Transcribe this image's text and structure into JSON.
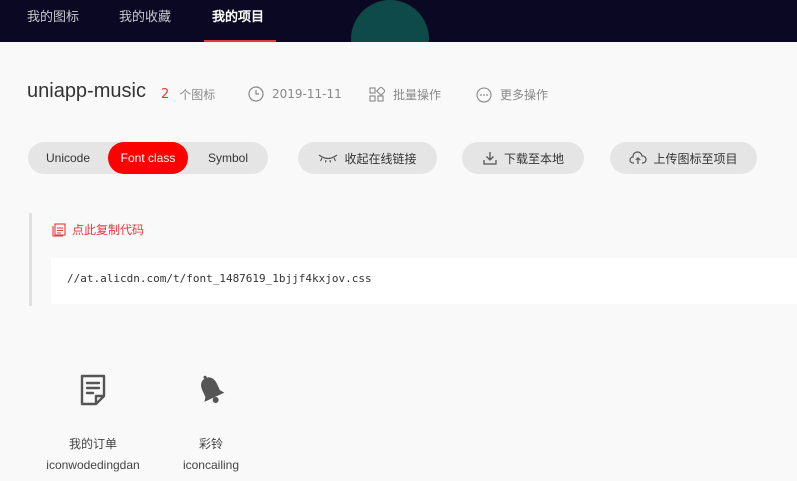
{
  "nav": {
    "tabs": [
      {
        "label": "我的图标"
      },
      {
        "label": "我的收藏"
      },
      {
        "label": "我的项目"
      }
    ]
  },
  "project": {
    "title": "uniapp-music",
    "icon_count": "2",
    "icon_count_unit": "个图标",
    "date": "2019-11-11",
    "batch_label": "批量操作",
    "more_label": "更多操作"
  },
  "format_tabs": {
    "unicode": "Unicode",
    "font_class": "Font class",
    "symbol": "Symbol",
    "active": "Font class"
  },
  "actions": {
    "collapse_link": "收起在线链接",
    "download": "下载至本地",
    "upload": "上传图标至项目"
  },
  "code": {
    "copy_label": "点此复制代码",
    "url": "//at.alicdn.com/t/font_1487619_1bjjf4kxjov.css"
  },
  "icons": [
    {
      "name": "我的订单",
      "class": "iconwodedingdan",
      "icon": "order-icon"
    },
    {
      "name": "彩铃",
      "class": "iconcailing",
      "icon": "bell-icon"
    }
  ],
  "colors": {
    "nav_bg": "#0a0822",
    "accent": "#ff0000",
    "link_red": "#e4393c"
  }
}
